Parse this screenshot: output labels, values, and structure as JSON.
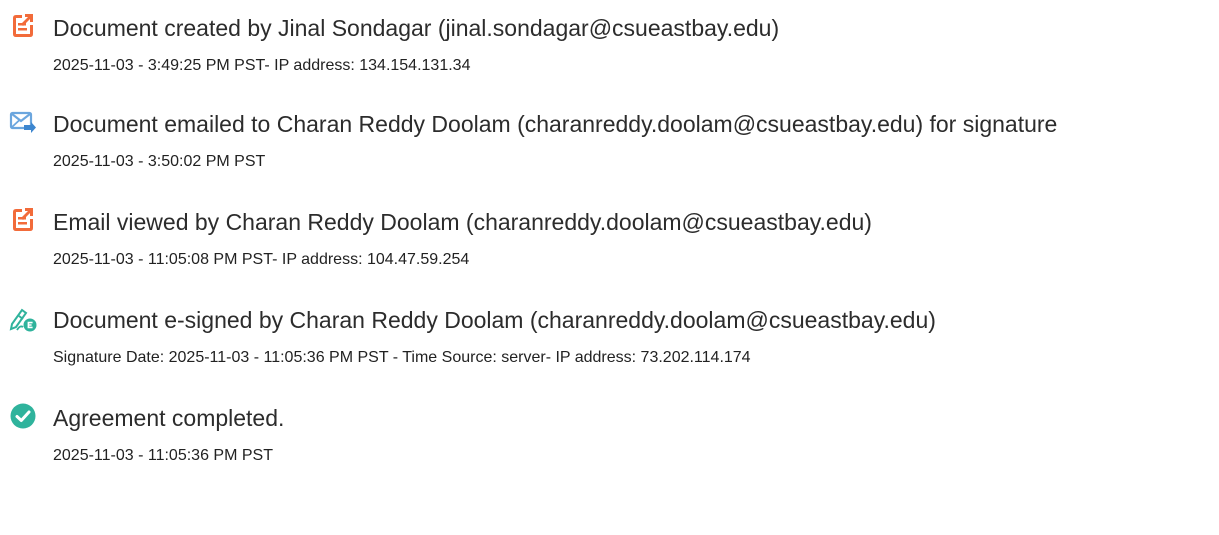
{
  "events": [
    {
      "icon": "document-created-icon",
      "title": "Document created by Jinal Sondagar (jinal.sondagar@csueastbay.edu)",
      "detail": "2025-11-03 - 3:49:25 PM PST- IP address: 134.154.131.34"
    },
    {
      "icon": "email-sent-icon",
      "title": "Document emailed to Charan Reddy Doolam (charanreddy.doolam@csueastbay.edu) for signature",
      "detail": "2025-11-03 - 3:50:02 PM PST"
    },
    {
      "icon": "email-viewed-icon",
      "title": "Email viewed by Charan Reddy Doolam (charanreddy.doolam@csueastbay.edu)",
      "detail": "2025-11-03 - 11:05:08 PM PST- IP address: 104.47.59.254"
    },
    {
      "icon": "e-signed-icon",
      "title": "Document e-signed by Charan Reddy Doolam (charanreddy.doolam@csueastbay.edu)",
      "detail": "Signature Date: 2025-11-03 - 11:05:36 PM PST - Time Source: server- IP address: 73.202.114.174"
    },
    {
      "icon": "completed-check-icon",
      "title": "Agreement completed.",
      "detail": "2025-11-03 - 11:05:36 PM PST"
    }
  ],
  "colors": {
    "document_icon": "#F26B3A",
    "email_icon": "#6BA6DE",
    "sign_icon": "#2FB39C",
    "check_icon": "#2FB39C",
    "text": "#2c2c2c"
  }
}
